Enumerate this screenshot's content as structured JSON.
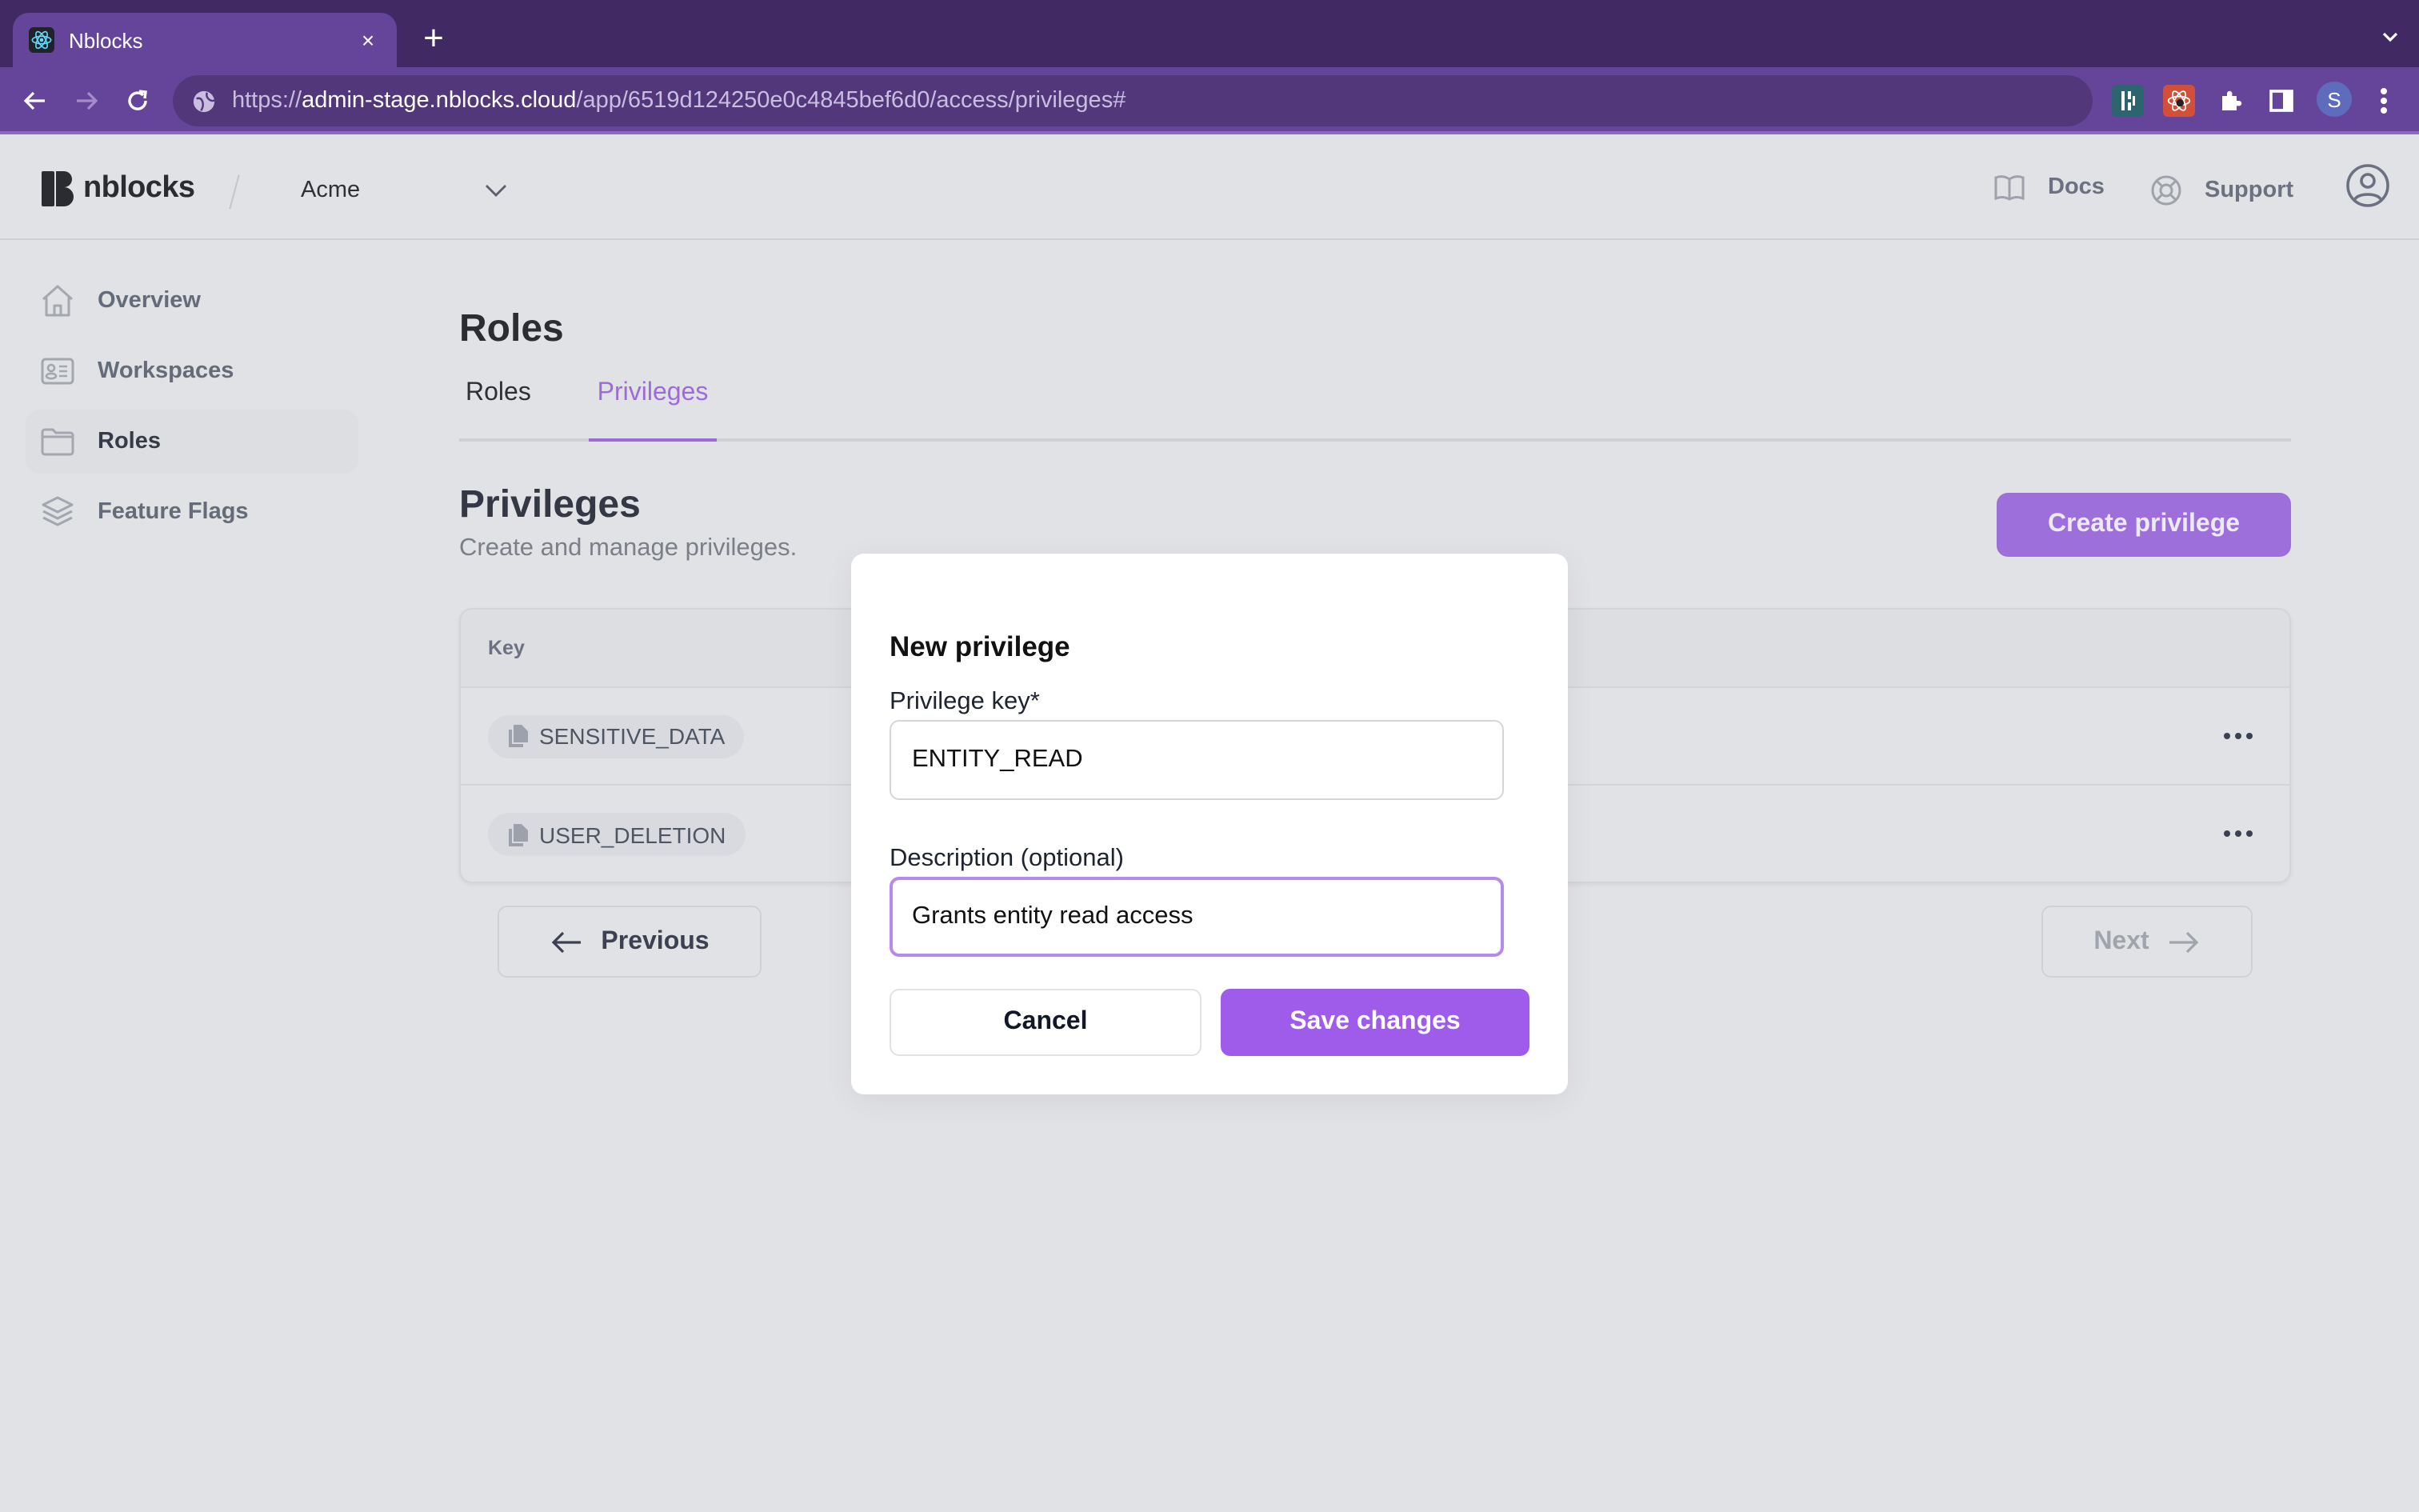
{
  "browser": {
    "tab_title": "Nblocks",
    "tab_close": "×",
    "new_tab": "+",
    "url_scheme": "https://",
    "url_host": "admin-stage.nblocks.cloud",
    "url_path": "/app/6519d124250e0c4845bef6d0/access/privileges#",
    "profile_initial": "S"
  },
  "header": {
    "logo_text": "nblocks",
    "workspace": "Acme",
    "docs_label": "Docs",
    "support_label": "Support"
  },
  "sidebar": {
    "items": [
      {
        "label": "Overview",
        "icon": "home-icon",
        "active": false
      },
      {
        "label": "Workspaces",
        "icon": "id-card-icon",
        "active": false
      },
      {
        "label": "Roles",
        "icon": "folder-icon",
        "active": true
      },
      {
        "label": "Feature Flags",
        "icon": "layers-icon",
        "active": false
      }
    ]
  },
  "main": {
    "title": "Roles",
    "tabs": [
      {
        "label": "Roles",
        "active": false
      },
      {
        "label": "Privileges",
        "active": true
      }
    ],
    "section_title": "Privileges",
    "section_subtitle": "Create and manage privileges.",
    "create_button": "Create privilege",
    "table": {
      "columns": [
        "Key"
      ],
      "rows": [
        {
          "key": "SENSITIVE_DATA"
        },
        {
          "key": "USER_DELETION"
        }
      ]
    },
    "pagination": {
      "previous": "Previous",
      "next": "Next"
    }
  },
  "modal": {
    "title": "New privilege",
    "key_label": "Privilege key*",
    "key_value": "ENTITY_READ",
    "description_label": "Description (optional)",
    "description_value": "Grants entity read access",
    "cancel": "Cancel",
    "save": "Save changes"
  },
  "colors": {
    "accent": "#9f5bea",
    "accent_muted": "#9d6fdb",
    "browser_frame": "#412a63",
    "browser_toolbar": "#65459a",
    "page_bg": "#e1e2e6"
  }
}
